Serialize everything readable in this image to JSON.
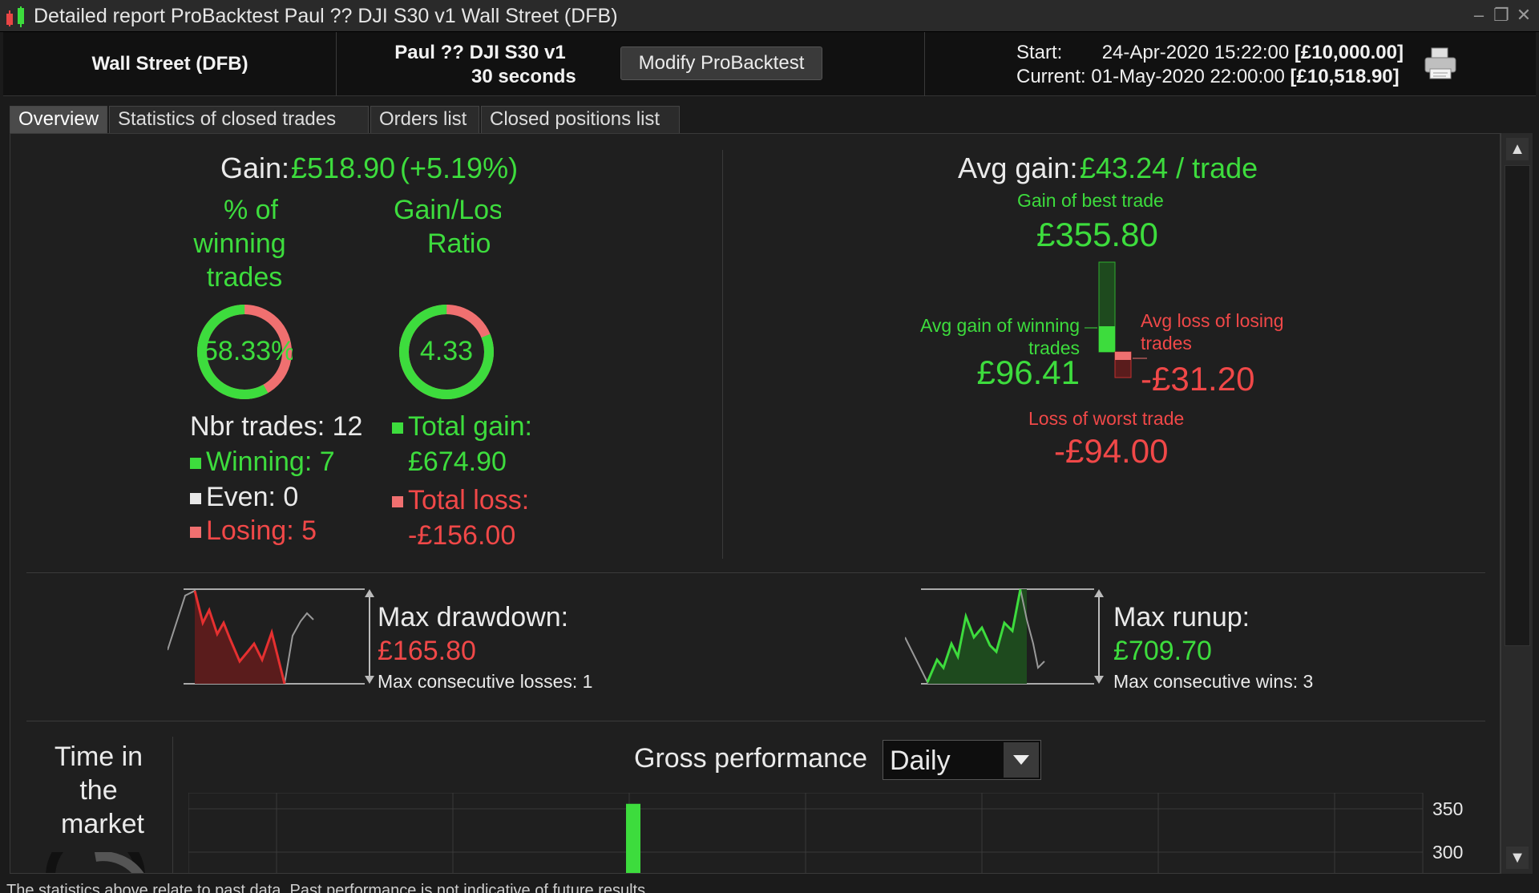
{
  "window": {
    "title": "Detailed report ProBacktest Paul ?? DJI S30 v1 Wall Street (DFB)"
  },
  "header": {
    "market": "Wall Street (DFB)",
    "strategy_name": "Paul ?? DJI S30 v1",
    "timeframe": "30 seconds",
    "modify_label": "Modify ProBacktest",
    "start_label": "Start:",
    "start_date": "24-Apr-2020 15:22:00",
    "start_capital": "[£10,000.00]",
    "current_label": "Current:",
    "current_date": "01-May-2020 22:00:00",
    "current_capital": "[£10,518.90]"
  },
  "tabs": [
    {
      "label": "Overview",
      "active": true
    },
    {
      "label": "Statistics of closed trades",
      "active": false
    },
    {
      "label": "Orders list",
      "active": false
    },
    {
      "label": "Closed positions list",
      "active": false
    }
  ],
  "overview": {
    "gain_label": "Gain:",
    "gain_value": "£518.90",
    "gain_pct": "(+5.19%)",
    "pct_winning_title_1": "% of",
    "pct_winning_title_2": "winning",
    "pct_winning_title_3": "trades",
    "pct_winning_value": "58.33%",
    "pct_winning_fraction": 0.5833,
    "gl_ratio_title_1": "Gain/Loss",
    "gl_ratio_title_2": "Ratio",
    "gl_ratio_value": "4.33",
    "gl_ratio_fraction": 0.812,
    "nbr_trades": "Nbr trades: 12",
    "winning": "Winning: 7",
    "even": "Even: 0",
    "losing": "Losing: 5",
    "total_gain_label": "Total gain:",
    "total_gain_value": "£674.90",
    "total_loss_label": "Total loss:",
    "total_loss_value": "-£156.00",
    "avg_gain_label": "Avg gain:",
    "avg_gain_value": "£43.24 / trade",
    "best_trade_label": "Gain of best trade",
    "best_trade_value": "£355.80",
    "avg_win_label_1": "Avg gain of winning",
    "avg_win_label_2": "trades",
    "avg_win_value": "£96.41",
    "avg_loss_label_1": "Avg loss of losing",
    "avg_loss_label_2": "trades",
    "avg_loss_value": "-£31.20",
    "worst_trade_label": "Loss of worst trade",
    "worst_trade_value": "-£94.00",
    "max_dd_label": "Max drawdown:",
    "max_dd_value": "£165.80",
    "max_consec_losses": "Max consecutive losses: 1",
    "max_runup_label": "Max runup:",
    "max_runup_value": "£709.70",
    "max_consec_wins": "Max consecutive wins: 3",
    "time_in_market_1": "Time in",
    "time_in_market_2": "the",
    "time_in_market_3": "market",
    "gross_perf_label": "Gross performance",
    "gross_perf_period": "Daily",
    "footer_note": "The statistics above relate to past data. Past performance is not indicative of future results."
  },
  "chart_data": {
    "type": "bar",
    "title": "Gross performance",
    "ylim": [
      280,
      360
    ],
    "y_ticks": [
      350,
      300
    ],
    "series": [
      {
        "values": [
          355.8
        ]
      }
    ]
  },
  "colors": {
    "gain": "#3ddc3d",
    "loss": "#f04848",
    "background": "#1f1f1f"
  }
}
